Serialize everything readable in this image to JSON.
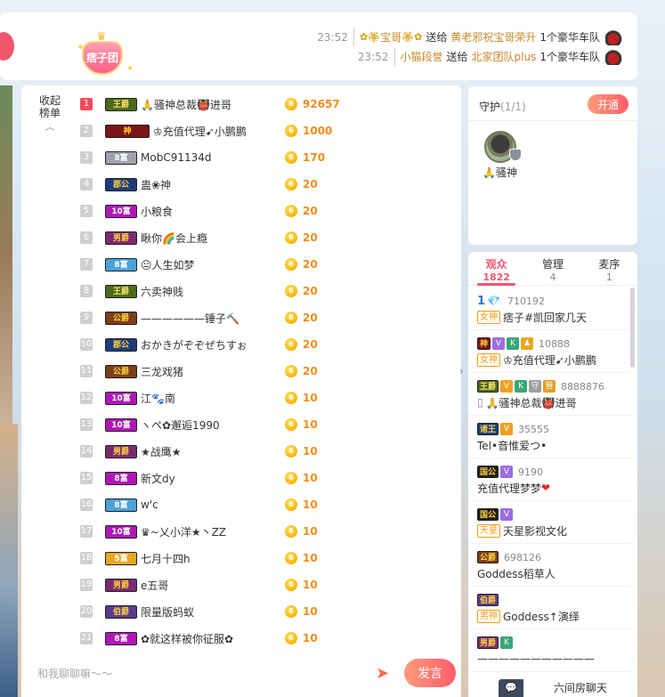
{
  "notice": {
    "fan_badge_label": "痞子团",
    "lines": [
      {
        "time": "23:52",
        "sender": "宝哥",
        "action": "送给",
        "receiver": "黄老邪祝宝哥荣升",
        "gift": "1个豪华车队"
      },
      {
        "time": "23:52",
        "sender": "小猫段誉",
        "action": "送给",
        "receiver": "北家团队plus",
        "gift": "1个豪华车队"
      }
    ]
  },
  "rank": {
    "collapse_label_1": "收起",
    "collapse_label_2": "榜单",
    "rows": [
      {
        "rank": "1",
        "level": "王爵",
        "level_class": "wang",
        "name": "🙏骚神总裁👹进哥",
        "score": "92657"
      },
      {
        "rank": "2",
        "level": "神",
        "level_class": "shen",
        "name": "♔充值代理➹小鹏鹏",
        "score": "1000"
      },
      {
        "rank": "3",
        "level": "8富",
        "level_class": "ding",
        "name": "MobC91134d",
        "score": "170"
      },
      {
        "rank": "4",
        "level": "郡公",
        "level_class": "jun",
        "name": "蛊❀神",
        "score": "20"
      },
      {
        "rank": "5",
        "level": "10富",
        "level_class": "duan10",
        "name": "小粮食",
        "score": "20"
      },
      {
        "rank": "6",
        "level": "男爵",
        "level_class": "nan",
        "name": "瞅你🌈会上瘾",
        "score": "20"
      },
      {
        "rank": "7",
        "level": "8富",
        "level_class": "duan8",
        "name": "😐人生如梦",
        "score": "20"
      },
      {
        "rank": "8",
        "level": "王爵",
        "level_class": "wang",
        "name": "六卖神贱",
        "score": "20"
      },
      {
        "rank": "9",
        "level": "公爵",
        "level_class": "gong",
        "name": "——————锤子🔨",
        "score": "20"
      },
      {
        "rank": "10",
        "level": "郡公",
        "level_class": "jun",
        "name": "おかきがぞぞぜちすぉ",
        "score": "20"
      },
      {
        "rank": "11",
        "level": "公爵",
        "level_class": "gong",
        "name": "三龙戏猪",
        "score": "20"
      },
      {
        "rank": "12",
        "level": "10富",
        "level_class": "duan10",
        "name": "江🐾南",
        "score": "10"
      },
      {
        "rank": "13",
        "level": "10富",
        "level_class": "duan10",
        "name": "ヽペ✿邂逅1990",
        "score": "10"
      },
      {
        "rank": "14",
        "level": "男爵",
        "level_class": "nan",
        "name": "★战鹰★",
        "score": "10"
      },
      {
        "rank": "15",
        "level": "8富",
        "level_class": "duan10",
        "name": "新文dy",
        "score": "10"
      },
      {
        "rank": "16",
        "level": "8富",
        "level_class": "duan8",
        "name": "w'c",
        "score": "10"
      },
      {
        "rank": "17",
        "level": "10富",
        "level_class": "duan10",
        "name": "♛~乂小洋★丶ZZ",
        "score": "10"
      },
      {
        "rank": "18",
        "level": "5富",
        "level_class": "duan5",
        "name": "七月十四h",
        "score": "10"
      },
      {
        "rank": "19",
        "level": "男爵",
        "level_class": "nan",
        "name": "e五哥",
        "score": "10"
      },
      {
        "rank": "20",
        "level": "伯爵",
        "level_class": "bo",
        "name": "限量版蚂蚁",
        "score": "10"
      },
      {
        "rank": "21",
        "level": "8富",
        "level_class": "duan10",
        "name": "✿就这样被你征服✿",
        "score": "10"
      }
    ]
  },
  "chat": {
    "placeholder": "和我聊聊嘛～～",
    "send_label": "发言"
  },
  "guard": {
    "title": "守护",
    "count": "(1/1)",
    "open_label": "开通",
    "member_name": "🙏骚神"
  },
  "audience": {
    "tabs": [
      {
        "label": "观众",
        "count": "1822"
      },
      {
        "label": "管理",
        "count": "4"
      },
      {
        "label": "麦序",
        "count": "1"
      }
    ],
    "items": [
      {
        "line1_rank": "1",
        "line1_fans": "710192",
        "tag": "女神",
        "name": "痞子#凯回家几天"
      },
      {
        "line1_level": "神",
        "line1_fans": "10888",
        "tag": "女神",
        "name": "♔充值代理➹小鹏鹏"
      },
      {
        "line1_level": "王爵",
        "line1_fans": "8888876",
        "tag": "",
        "name": "🙏骚神总裁👹进哥"
      },
      {
        "line1_level": "诸王",
        "line1_fans": "35555",
        "tag": "",
        "name": "Tel•音惟爱つ•"
      },
      {
        "line1_level": "国公",
        "line1_fans": "9190",
        "tag": "",
        "name": "充值代理梦梦"
      },
      {
        "line1_level": "国公",
        "line1_fans": "",
        "tag": "天星",
        "name": "天星影视文化"
      },
      {
        "line1_level": "公爵",
        "line1_fans": "698126",
        "tag": "",
        "name": "Goddess稻草人"
      },
      {
        "line1_level": "伯爵",
        "line1_fans": "",
        "tag": "男神",
        "name": "Goddess↑演绎"
      },
      {
        "line1_level": "男爵",
        "line1_fans": "",
        "tag": "",
        "name": "———————————"
      }
    ]
  },
  "bottom_chat": {
    "label": "六间房聊天"
  },
  "colors": {
    "accent": "#f2566d",
    "score": "#f08c1a",
    "gold_text": "#c8892a"
  }
}
